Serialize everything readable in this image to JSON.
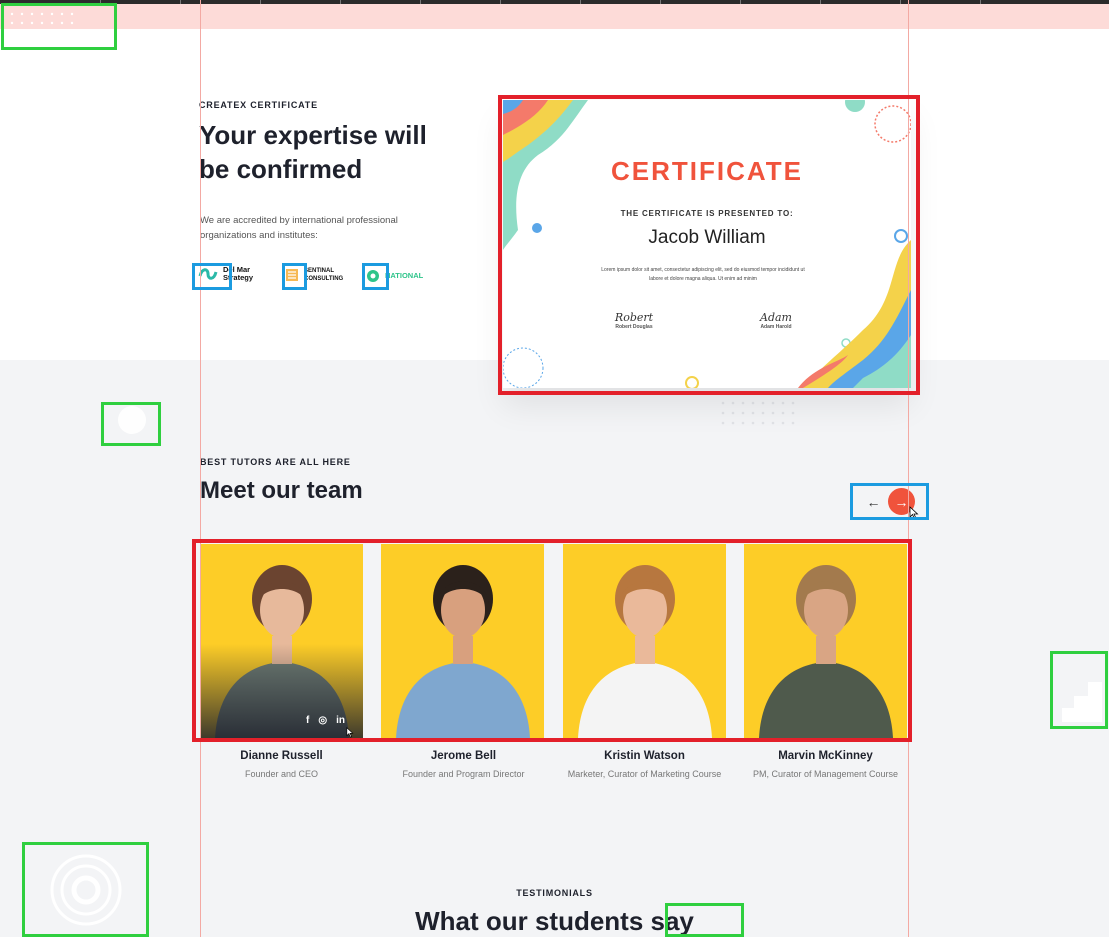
{
  "certificate_section": {
    "eyebrow": "CREATEX CERTIFICATE",
    "title_line1": "Your expertise will",
    "title_line2": "be confirmed",
    "description_line1": "We are accredited by international professional",
    "description_line2": "organizations and institutes:",
    "logos": [
      {
        "line1": "Del Mar",
        "line2": "Strategy",
        "icon": "swirl-logo-icon"
      },
      {
        "line1": "SENTINAL",
        "line2": "CONSULTING",
        "icon": "stack-logo-icon"
      },
      {
        "line1": "NATIONAL",
        "line2": "",
        "icon": "shield-logo-icon"
      }
    ],
    "certificate": {
      "title": "CERTIFICATE",
      "presented_to": "THE CERTIFICATE IS PRESENTED TO:",
      "name": "Jacob William",
      "lorem_line1": "Lorem ipsum dolor sit amet, consectetur adipiscing elit, sed do eiusmod tempor incididunt ut",
      "lorem_line2": "labore et dolore magna aliqua. Ut enim ad minim",
      "signatures": [
        {
          "script": "Robert",
          "name": "Robert Douglas"
        },
        {
          "script": "Adam",
          "name": "Adam Harold"
        }
      ]
    }
  },
  "team_section": {
    "eyebrow": "BEST TUTORS ARE ALL HERE",
    "title": "Meet our team",
    "prev_arrow": "←",
    "next_arrow": "→",
    "members": [
      {
        "name": "Dianne Russell",
        "role": "Founder and CEO",
        "hair": "#6b4430",
        "shirt": "#6f7d74",
        "skin": "#e7b99b"
      },
      {
        "name": "Jerome Bell",
        "role": "Founder and Program Director",
        "hair": "#2b211b",
        "shirt": "#7fa7cf",
        "skin": "#d8a07e"
      },
      {
        "name": "Kristin Watson",
        "role": "Marketer, Curator of Marketing Course",
        "hair": "#b7773f",
        "shirt": "#f4f4f4",
        "skin": "#eab99a"
      },
      {
        "name": "Marvin McKinney",
        "role": "PM, Curator of Management Course",
        "hair": "#a37a4d",
        "shirt": "#4f5a4c",
        "skin": "#d9a584"
      }
    ],
    "social": {
      "facebook": "f",
      "instagram": "◎",
      "linkedin": "in"
    }
  },
  "testimonials_section": {
    "eyebrow": "TESTIMONIALS",
    "title": "What our students say"
  },
  "colors": {
    "accent": "#f0533c",
    "card_yellow": "#fdcd27",
    "heading": "#1e212c",
    "annotation_red": "#e3202a",
    "annotation_green": "#2fcf3f",
    "annotation_blue": "#1b9be0"
  }
}
